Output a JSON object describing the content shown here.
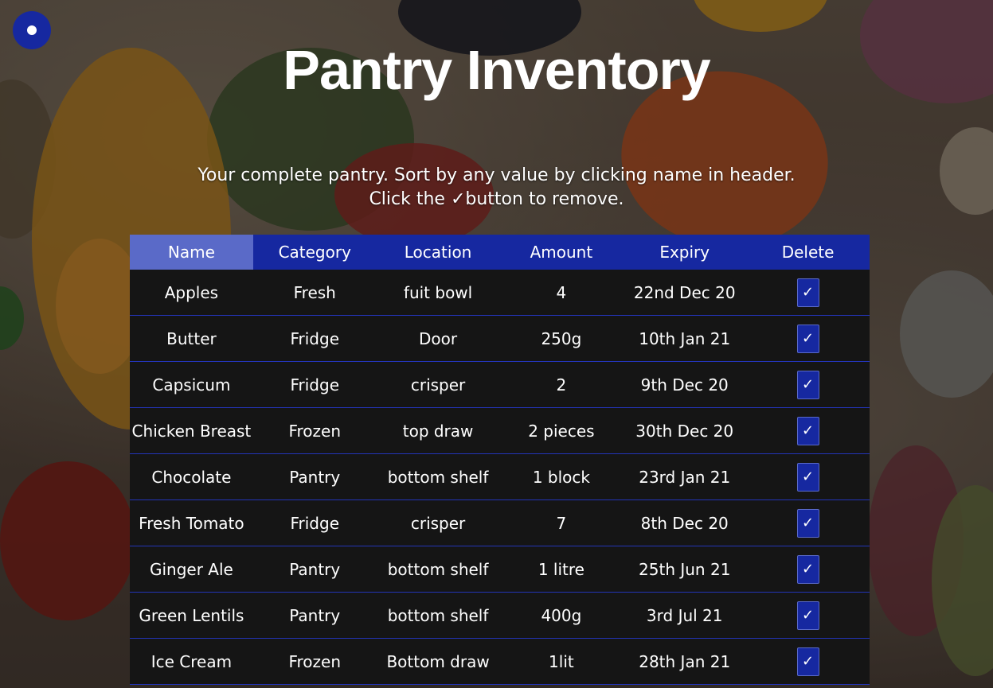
{
  "page": {
    "title": "Pantry Inventory",
    "subtitle_line1": "Your complete pantry. Sort by any value by clicking name in header.",
    "subtitle_line2": "Click the ✓button to remove."
  },
  "menu_button": {
    "icon": "dot-icon"
  },
  "colors": {
    "accent": "#1628a0",
    "active_header": "#5a6ac8",
    "row_background": "#151515",
    "row_border": "#2334b8"
  },
  "table": {
    "headers": [
      "Name",
      "Category",
      "Location",
      "Amount",
      "Expiry",
      "Delete"
    ],
    "active_sort_column": "Name",
    "delete_icon": "✓",
    "rows": [
      {
        "name": "Apples",
        "category": "Fresh",
        "location": "fuit bowl",
        "amount": "4",
        "expiry": "22nd Dec 20"
      },
      {
        "name": "Butter",
        "category": "Fridge",
        "location": "Door",
        "amount": "250g",
        "expiry": "10th Jan 21"
      },
      {
        "name": "Capsicum",
        "category": "Fridge",
        "location": "crisper",
        "amount": "2",
        "expiry": "9th Dec 20"
      },
      {
        "name": "Chicken Breast",
        "category": "Frozen",
        "location": "top draw",
        "amount": "2 pieces",
        "expiry": "30th Dec 20"
      },
      {
        "name": "Chocolate",
        "category": "Pantry",
        "location": "bottom shelf",
        "amount": "1 block",
        "expiry": "23rd Jan 21"
      },
      {
        "name": "Fresh Tomato",
        "category": "Fridge",
        "location": "crisper",
        "amount": "7",
        "expiry": "8th Dec 20"
      },
      {
        "name": "Ginger Ale",
        "category": "Pantry",
        "location": "bottom shelf",
        "amount": "1 litre",
        "expiry": "25th Jun 21"
      },
      {
        "name": "Green Lentils",
        "category": "Pantry",
        "location": "bottom shelf",
        "amount": "400g",
        "expiry": "3rd Jul 21"
      },
      {
        "name": "Ice Cream",
        "category": "Frozen",
        "location": "Bottom draw",
        "amount": "1lit",
        "expiry": "28th Jan 21"
      }
    ]
  }
}
